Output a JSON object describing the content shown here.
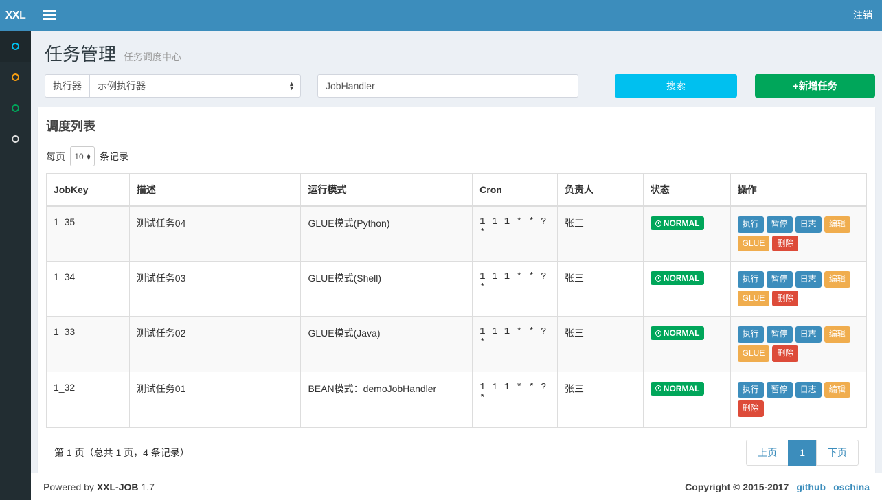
{
  "brand": {
    "text_1": "XX",
    "text_2": "L"
  },
  "topbar": {
    "menu_icon": "hamburger-icon",
    "logout_label": "注销",
    "bg_color": "#3c8dbc"
  },
  "sidebar": {
    "bg_color": "#222d32",
    "items": [
      {
        "icon": "circle-icon",
        "color": "#00c0ef",
        "active": true
      },
      {
        "icon": "circle-icon",
        "color": "#f39c12",
        "active": false
      },
      {
        "icon": "circle-icon",
        "color": "#00a65a",
        "active": false
      },
      {
        "icon": "circle-icon",
        "color": "#dedede",
        "active": false
      }
    ]
  },
  "page": {
    "title": "任务管理",
    "subtitle": "任务调度中心"
  },
  "toolbar": {
    "executor_label": "执行器",
    "executor_value": "示例执行器",
    "jobhandler_label": "JobHandler",
    "jobhandler_value": "",
    "jobhandler_placeholder": "",
    "search_label": "搜索",
    "search_color": "#00c0ef",
    "add_label": "+新增任务",
    "add_color": "#00a65a"
  },
  "box": {
    "title": "调度列表",
    "length": {
      "prefix": "每页",
      "value": "10",
      "suffix": "条记录"
    }
  },
  "table": {
    "columns": [
      "JobKey",
      "描述",
      "运行模式",
      "Cron",
      "负责人",
      "状态",
      "操作"
    ],
    "rows": [
      {
        "jobkey": "1_35",
        "desc": "测试任务04",
        "mode": "GLUE模式(Python)",
        "cron": "1 1 1 * * ? *",
        "owner": "张三",
        "status": "NORMAL",
        "status_icon": "clock-icon",
        "status_color": "#00a65a",
        "ops": [
          {
            "label": "执行",
            "color": "#3c8dbc",
            "style": "blue"
          },
          {
            "label": "暂停",
            "color": "#3c8dbc",
            "style": "blue"
          },
          {
            "label": "日志",
            "color": "#3c8dbc",
            "style": "blue"
          },
          {
            "label": "编辑",
            "color": "#f0ad4e",
            "style": "orange"
          },
          {
            "label": "GLUE",
            "color": "#f0ad4e",
            "style": "orange"
          },
          {
            "label": "删除",
            "color": "#dd4b39",
            "style": "red"
          }
        ]
      },
      {
        "jobkey": "1_34",
        "desc": "测试任务03",
        "mode": "GLUE模式(Shell)",
        "cron": "1 1 1 * * ? *",
        "owner": "张三",
        "status": "NORMAL",
        "status_icon": "clock-icon",
        "status_color": "#00a65a",
        "ops": [
          {
            "label": "执行",
            "color": "#3c8dbc",
            "style": "blue"
          },
          {
            "label": "暂停",
            "color": "#3c8dbc",
            "style": "blue"
          },
          {
            "label": "日志",
            "color": "#3c8dbc",
            "style": "blue"
          },
          {
            "label": "编辑",
            "color": "#f0ad4e",
            "style": "orange"
          },
          {
            "label": "GLUE",
            "color": "#f0ad4e",
            "style": "orange"
          },
          {
            "label": "删除",
            "color": "#dd4b39",
            "style": "red"
          }
        ]
      },
      {
        "jobkey": "1_33",
        "desc": "测试任务02",
        "mode": "GLUE模式(Java)",
        "cron": "1 1 1 * * ? *",
        "owner": "张三",
        "status": "NORMAL",
        "status_icon": "clock-icon",
        "status_color": "#00a65a",
        "ops": [
          {
            "label": "执行",
            "color": "#3c8dbc",
            "style": "blue"
          },
          {
            "label": "暂停",
            "color": "#3c8dbc",
            "style": "blue"
          },
          {
            "label": "日志",
            "color": "#3c8dbc",
            "style": "blue"
          },
          {
            "label": "编辑",
            "color": "#f0ad4e",
            "style": "orange"
          },
          {
            "label": "GLUE",
            "color": "#f0ad4e",
            "style": "orange"
          },
          {
            "label": "删除",
            "color": "#dd4b39",
            "style": "red"
          }
        ]
      },
      {
        "jobkey": "1_32",
        "desc": "测试任务01",
        "mode": "BEAN模式：demoJobHandler",
        "cron": "1 1 1 * * ? *",
        "owner": "张三",
        "status": "NORMAL",
        "status_icon": "clock-icon",
        "status_color": "#00a65a",
        "ops": [
          {
            "label": "执行",
            "color": "#3c8dbc",
            "style": "blue"
          },
          {
            "label": "暂停",
            "color": "#3c8dbc",
            "style": "blue"
          },
          {
            "label": "日志",
            "color": "#3c8dbc",
            "style": "blue"
          },
          {
            "label": "编辑",
            "color": "#f0ad4e",
            "style": "orange"
          },
          {
            "label": "删除",
            "color": "#dd4b39",
            "style": "red"
          }
        ]
      }
    ]
  },
  "pagination": {
    "info": "第 1 页（总共 1 页，4 条记录）",
    "prev_label": "上页",
    "next_label": "下页",
    "pages": [
      "1"
    ],
    "current_page": "1",
    "active_color": "#3c8dbc"
  },
  "footer": {
    "powered_prefix": "Powered by",
    "powered_name": "XXL-JOB",
    "powered_version": "1.7",
    "copyright": "Copyright © 2015-2017",
    "links": [
      "github",
      "oschina"
    ]
  }
}
